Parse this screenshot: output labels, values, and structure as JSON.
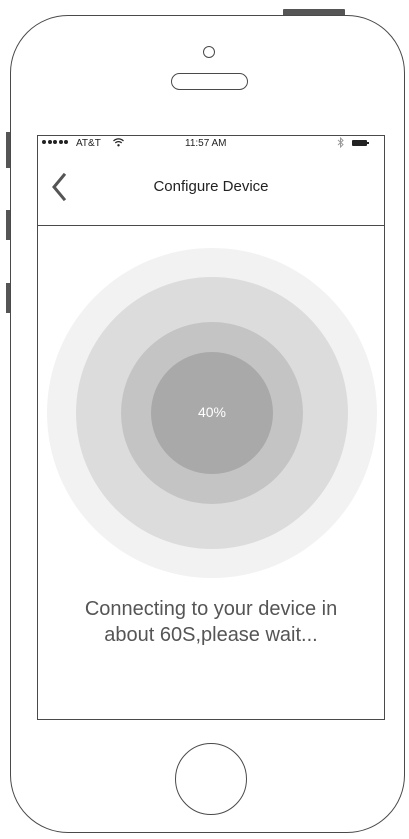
{
  "status_bar": {
    "carrier": "AT&T",
    "wifi_icon": "wifi-icon",
    "time": "11:57 AM",
    "bluetooth_icon": "bluetooth-icon",
    "battery_icon": "battery-icon"
  },
  "nav": {
    "back_icon": "chevron-left-icon",
    "title": "Configure Device"
  },
  "progress": {
    "label": "40%",
    "value": 40
  },
  "message": {
    "line1": "Connecting to your device in",
    "line2": "about 60S,please wait..."
  },
  "colors": {
    "ring_outer": "#f2f2f2",
    "ring_2": "#dcdcdc",
    "ring_3": "#c4c4c4",
    "ring_inner": "#a9a9a9",
    "text_muted": "#555555"
  }
}
